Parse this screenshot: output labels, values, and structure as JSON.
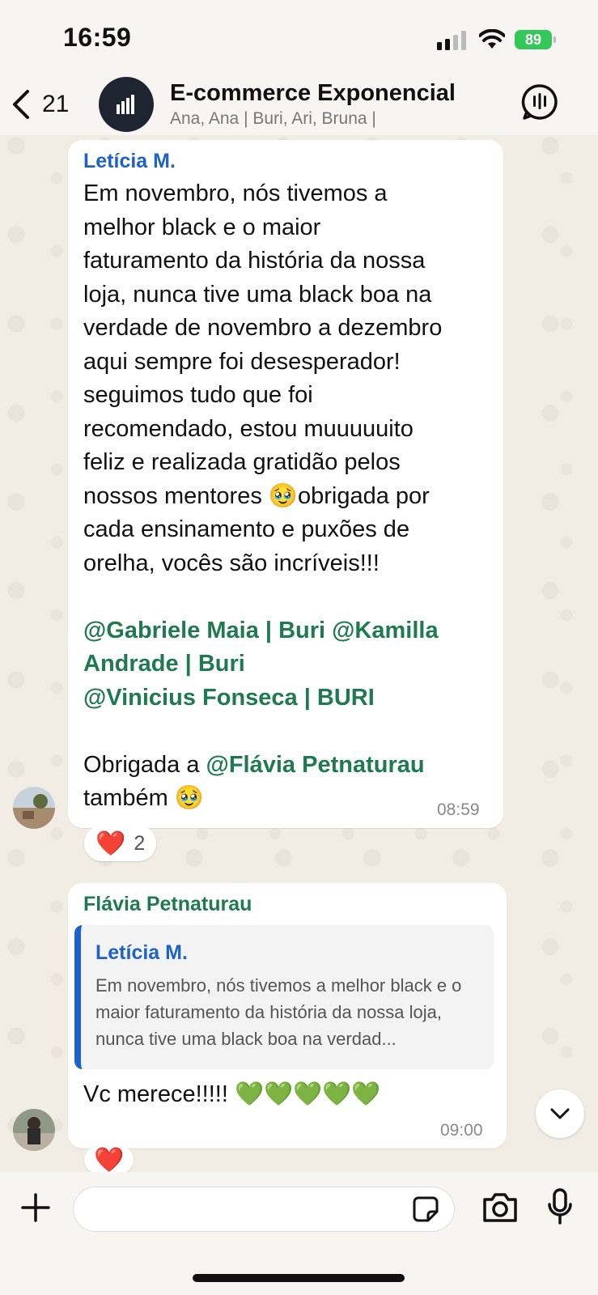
{
  "status_bar": {
    "time": "16:59",
    "battery": "89"
  },
  "header": {
    "back_count": "21",
    "title": "E-commerce Exponencial",
    "subtitle": "Ana, Ana | Buri, Ari, Bruna |"
  },
  "messages": [
    {
      "sender": "Letícia M.",
      "lines": [
        "Em novembro, nós tivemos a",
        "melhor black e o maior",
        "faturamento da história da nossa",
        "loja, nunca tive uma black boa na",
        "verdade de novembro a dezembro",
        "aqui sempre foi desesperador!",
        "seguimos tudo que foi",
        "recomendado, estou muuuuuito",
        "feliz e realizada gratidão pelos",
        "nossos mentores 🥹obrigada por",
        "cada ensinamento e puxões de",
        "orelha, vocês são incríveis!!!"
      ],
      "mentions": {
        "m1": "@Gabriele Maia | Buri",
        "m2a": "@Kamilla",
        "m2b": "Andrade | Buri",
        "m3": "@Vinicius Fonseca | BURI",
        "thanks_prefix": "Obrigada a ",
        "m4": "@Flávia Petnaturau",
        "thanks_suffix": "também 🥹"
      },
      "time": "08:59",
      "reaction": {
        "emoji": "❤️",
        "count": "2"
      }
    },
    {
      "sender": "Flávia Petnaturau",
      "quote": {
        "sender": "Letícia M.",
        "text": "Em novembro, nós tivemos a melhor black e o maior faturamento da história da nossa loja, nunca tive uma black boa na verdad..."
      },
      "text": "Vc merece!!!!! 💚💚💚💚💚",
      "time": "09:00",
      "reaction": {
        "emoji": "❤️"
      }
    }
  ],
  "colors": {
    "sender1": "#1d63c6",
    "sender2": "#1f7a52",
    "mention": "#1f7a52",
    "battery": "#34c759"
  },
  "icons": [
    "back-chevron-icon",
    "group-avatar-icon",
    "voice-call-icon",
    "chevron-down-icon",
    "plus-icon",
    "sticker-icon",
    "camera-icon",
    "microphone-icon"
  ]
}
